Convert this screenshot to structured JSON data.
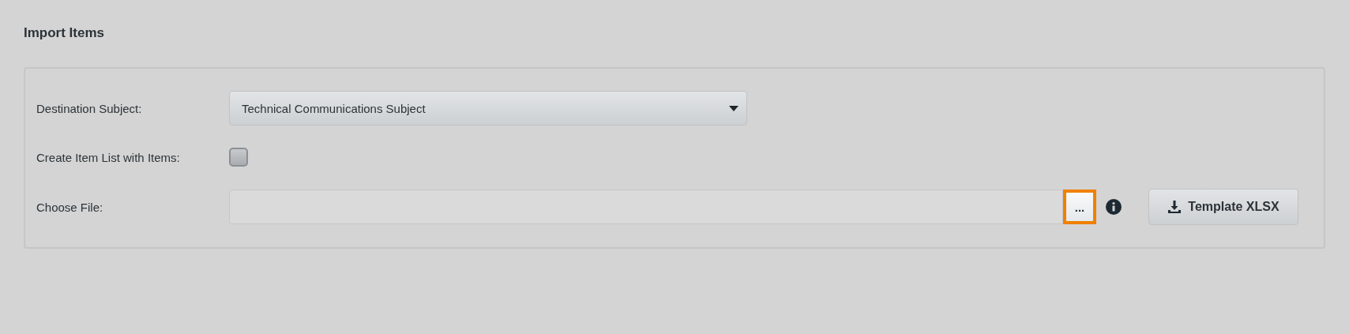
{
  "title": "Import Items",
  "form": {
    "destination": {
      "label": "Destination Subject:",
      "value": "Technical Communications Subject"
    },
    "create_list": {
      "label": "Create Item List with Items:",
      "checked": false
    },
    "file": {
      "label": "Choose File:",
      "browse": {
        "label": "...",
        "focused": true
      },
      "template_button": "Template XLSX"
    }
  }
}
